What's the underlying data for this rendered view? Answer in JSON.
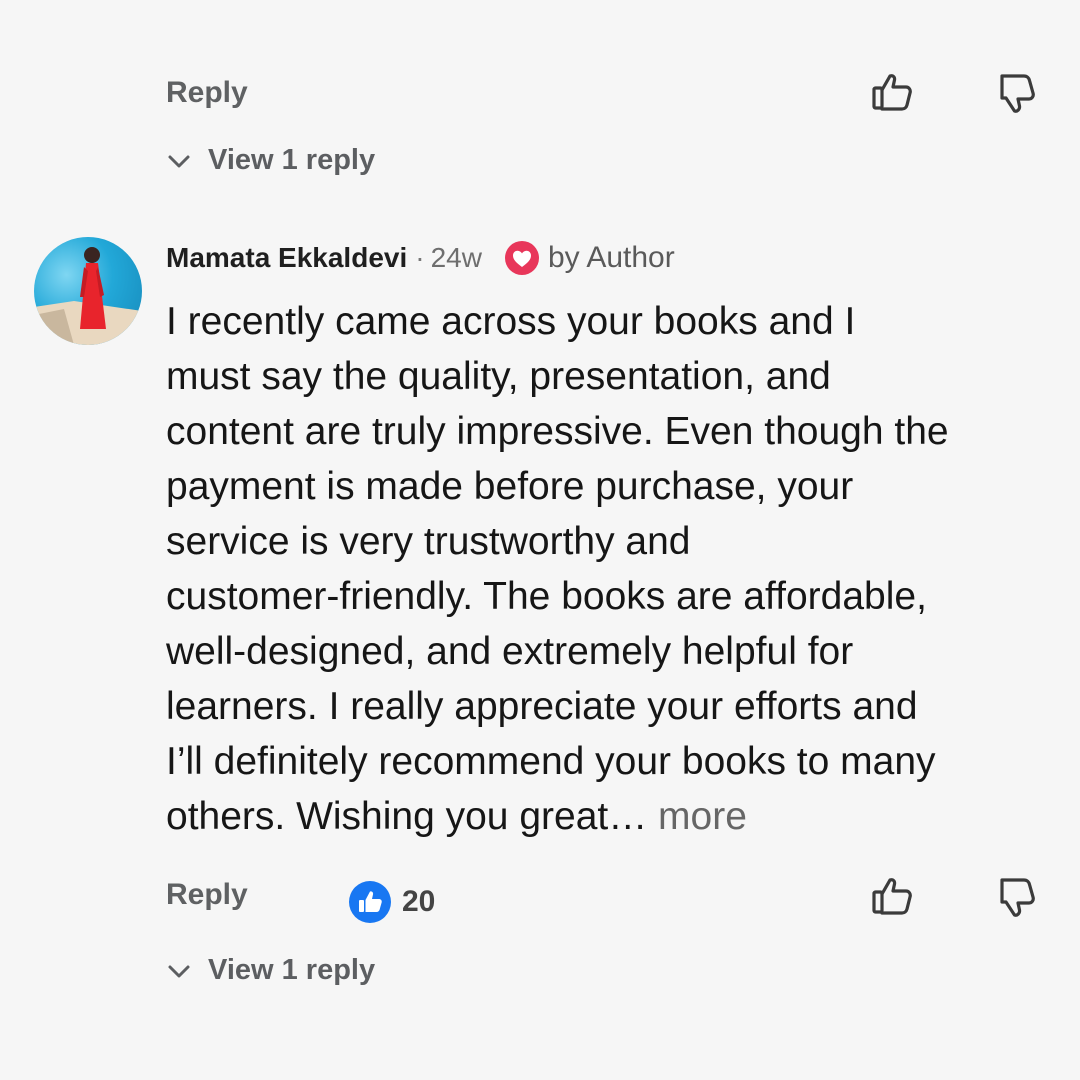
{
  "top_comment": {
    "reply_label": "Reply",
    "view_replies_label": "View 1 reply"
  },
  "comment": {
    "author": "Mamata Ekkaldevi",
    "separator": "·",
    "age": "24w",
    "author_badge": "by Author",
    "text_lines": [
      "I recently came across your books and I",
      "must say the quality, presentation, and",
      "content are truly impressive. Even though the",
      "payment is made before purchase, your",
      "service is very trustworthy and",
      "customer-friendly. The books are affordable,",
      "well-designed, and extremely helpful for",
      "learners. I really appreciate your efforts and",
      "I’ll definitely recommend your books to many",
      "others. Wishing you great…"
    ],
    "more_label": " more",
    "reply_label": "Reply",
    "like_count": "20",
    "view_replies_label": "View 1 reply"
  },
  "colors": {
    "background": "#f6f6f6",
    "like_blue": "#1877f2",
    "heart_badge": "#e8365a"
  },
  "icons": {
    "like": "thumbs-up-outline-icon",
    "dislike": "thumbs-down-outline-icon",
    "chevron": "chevron-down-icon",
    "heart": "heart-badge-icon",
    "like_filled": "thumbs-up-filled-icon"
  }
}
